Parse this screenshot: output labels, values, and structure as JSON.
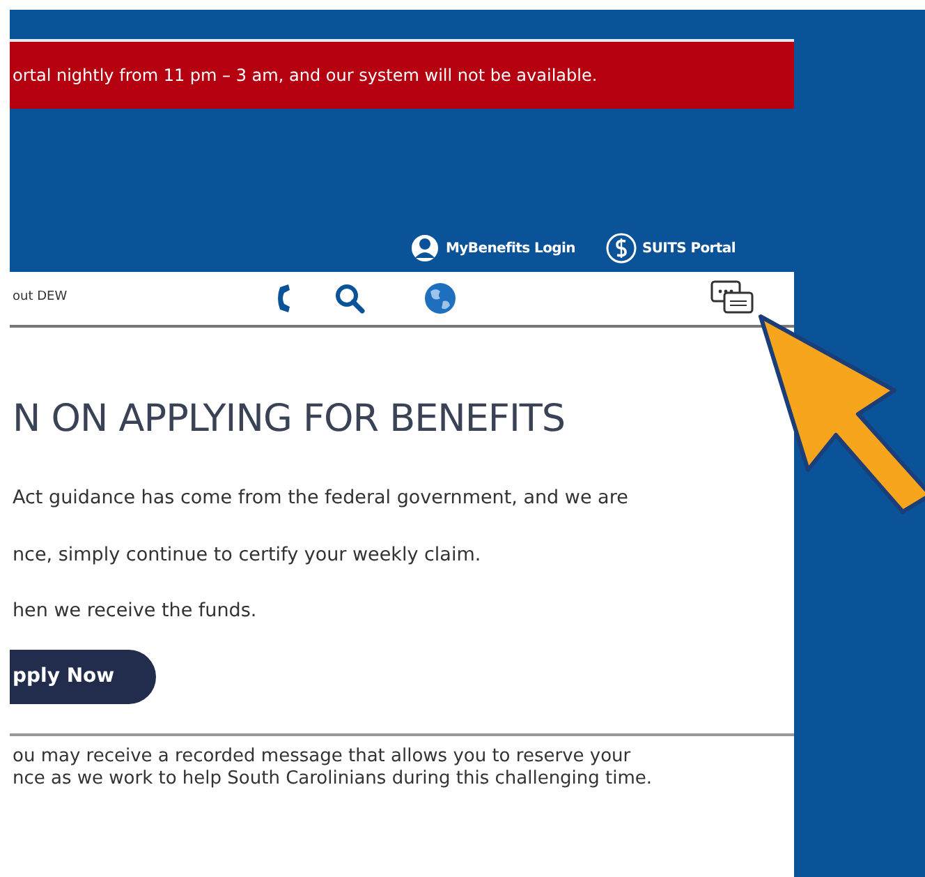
{
  "alert": {
    "text": "ortal nightly from 11 pm – 3 am, and our system will not be available."
  },
  "header_links": [
    {
      "label": "MyBenefits Login",
      "kind": "user"
    },
    {
      "label": "SUITS Portal",
      "kind": "dollar"
    }
  ],
  "nav": {
    "item": "out DEW"
  },
  "content": {
    "title": "N ON APPLYING FOR BENEFITS",
    "paragraphs": [
      "Act guidance has come from the federal government, and we are",
      "nce, simply continue to certify your weekly claim.",
      "hen we receive the funds."
    ],
    "button": "pply Now",
    "notice": [
      "ou may receive a recorded message that allows you to reserve your",
      "nce as we work to help South Carolinians during this challenging time."
    ]
  }
}
